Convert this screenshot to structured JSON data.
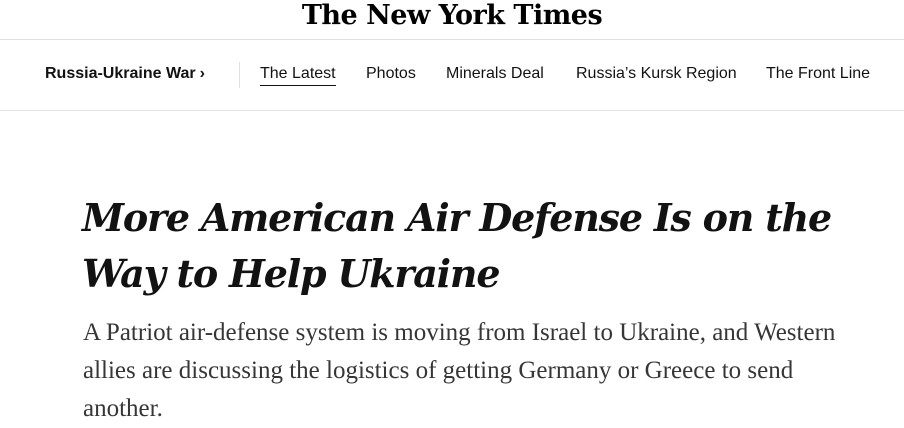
{
  "masthead": {
    "logo_text": "The New York Times"
  },
  "subnav": {
    "section_label": "Russia-Ukraine War",
    "section_chevron": "›",
    "items": [
      {
        "label": "The Latest",
        "active": true
      },
      {
        "label": "Photos"
      },
      {
        "label": "Minerals Deal"
      },
      {
        "label": "Russia’s Kursk Region"
      },
      {
        "label": "The Front Line"
      }
    ]
  },
  "article": {
    "headline": "More American Air Defense Is on the Way to Help Ukraine",
    "summary": "A Patriot air-defense system is moving from Israel to Ukraine, and Western allies are discussing the logistics of getting Germany or Greece to send another."
  },
  "colors": {
    "text": "#121212",
    "summary_text": "#363636",
    "rule": "#e2e2e2"
  }
}
